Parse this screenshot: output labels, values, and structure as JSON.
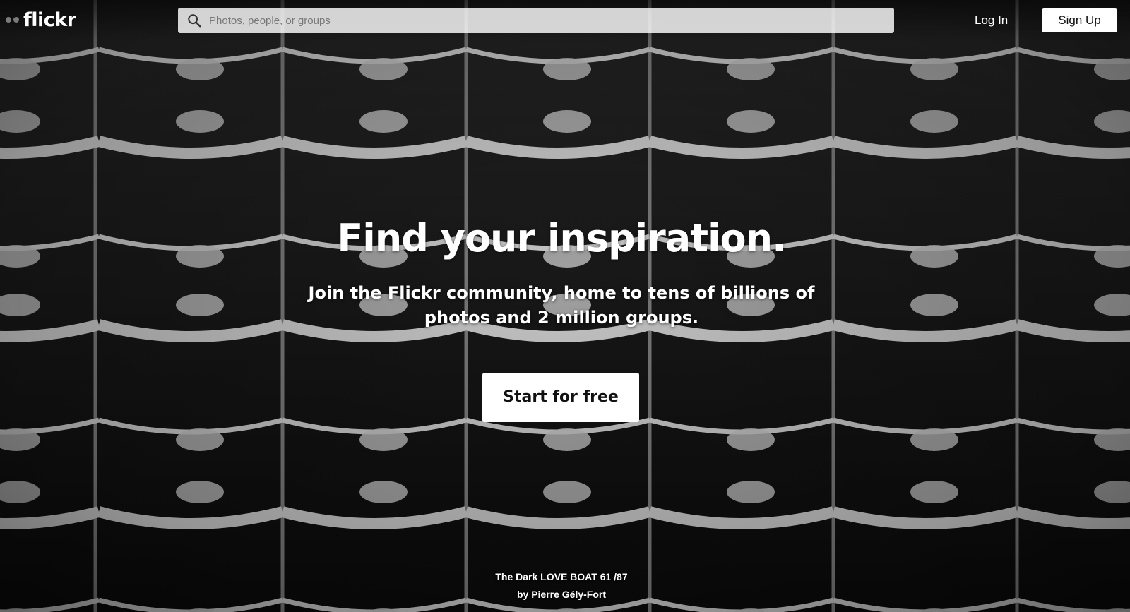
{
  "brand": {
    "logo_text": "flickr",
    "logo_icon": "flickr-dots-icon"
  },
  "header": {
    "search": {
      "placeholder": "Photos, people, or groups",
      "value": "",
      "icon": "search-icon"
    },
    "login_label": "Log In",
    "signup_label": "Sign Up"
  },
  "hero": {
    "title": "Find your inspiration.",
    "subtitle": "Join the Flickr community, home to tens of billions of photos and 2 million groups.",
    "cta_label": "Start for free"
  },
  "photo_credit": {
    "title": "The Dark LOVE BOAT 61 /87",
    "by_prefix": "by",
    "author": "Pierre Gély-Fort"
  },
  "colors": {
    "text": "#ffffff",
    "button_bg": "#ffffff",
    "button_text": "#111111"
  }
}
